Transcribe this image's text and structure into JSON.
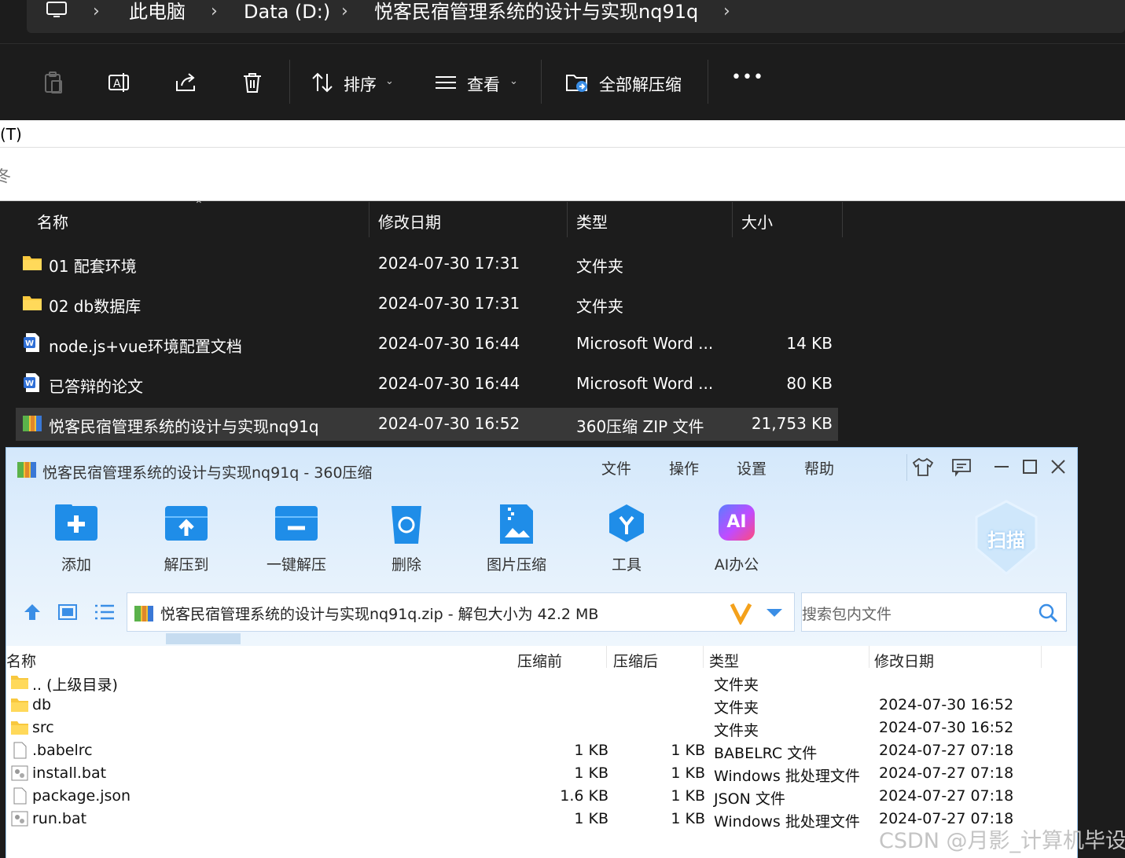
{
  "explorer": {
    "breadcrumb": [
      "此电脑",
      "Data (D:)",
      "悦客民宿管理系统的设计与实现nq91q"
    ],
    "toolbar": {
      "sort_label": "排序",
      "view_label": "查看",
      "extract_all_label": "全部解压缩",
      "more_label": "•••"
    },
    "strip_text_1": "(T)",
    "strip_text_2": "冬",
    "columns": {
      "name": "名称",
      "modified": "修改日期",
      "type": "类型",
      "size": "大小"
    },
    "files": [
      {
        "name": "01 配套环境",
        "modified": "2024-07-30 17:31",
        "type": "文件夹",
        "size": "",
        "icon": "folder-icon"
      },
      {
        "name": "02 db数据库",
        "modified": "2024-07-30 17:31",
        "type": "文件夹",
        "size": "",
        "icon": "folder-icon"
      },
      {
        "name": "node.js+vue环境配置文档",
        "modified": "2024-07-30 16:44",
        "type": "Microsoft Word ...",
        "size": "14 KB",
        "icon": "word-doc-icon"
      },
      {
        "name": "已答辩的论文",
        "modified": "2024-07-30 16:44",
        "type": "Microsoft Word ...",
        "size": "80 KB",
        "icon": "word-doc-icon"
      },
      {
        "name": "悦客民宿管理系统的设计与实现nq91q",
        "modified": "2024-07-30 16:52",
        "type": "360压缩 ZIP 文件",
        "size": "21,753 KB",
        "icon": "zip-archive-icon",
        "selected": true
      }
    ]
  },
  "archiver": {
    "title": "悦客民宿管理系统的设计与实现nq91q - 360压缩",
    "menu": [
      "文件",
      "操作",
      "设置",
      "帮助"
    ],
    "tools": [
      "添加",
      "解压到",
      "一键解压",
      "删除",
      "图片压缩",
      "工具",
      "AI办公"
    ],
    "scan_label": "扫描",
    "ai_badge": "AI",
    "address": "悦客民宿管理系统的设计与实现nq91q.zip - 解包大小为 42.2 MB",
    "search_placeholder": "搜索包内文件",
    "columns": {
      "name": "名称",
      "before": "压缩前",
      "after": "压缩后",
      "type": "类型",
      "modified": "修改日期"
    },
    "entries": [
      {
        "name": ".. (上级目录)",
        "before": "",
        "after": "",
        "type": "文件夹",
        "modified": "",
        "icon": "folder-icon"
      },
      {
        "name": "db",
        "before": "",
        "after": "",
        "type": "文件夹",
        "modified": "2024-07-30 16:52",
        "icon": "folder-icon"
      },
      {
        "name": "src",
        "before": "",
        "after": "",
        "type": "文件夹",
        "modified": "2024-07-30 16:52",
        "icon": "folder-icon"
      },
      {
        "name": ".babelrc",
        "before": "1 KB",
        "after": "1 KB",
        "type": "BABELRC 文件",
        "modified": "2024-07-27 07:18",
        "icon": "blank-file-icon"
      },
      {
        "name": "install.bat",
        "before": "1 KB",
        "after": "1 KB",
        "type": "Windows 批处理文件",
        "modified": "2024-07-27 07:18",
        "icon": "batch-file-icon"
      },
      {
        "name": "package.json",
        "before": "1.6 KB",
        "after": "1 KB",
        "type": "JSON 文件",
        "modified": "2024-07-27 07:18",
        "icon": "blank-file-icon"
      },
      {
        "name": "run.bat",
        "before": "1 KB",
        "after": "1 KB",
        "type": "Windows 批处理文件",
        "modified": "2024-07-27 07:18",
        "icon": "batch-file-icon"
      }
    ]
  },
  "watermark": "CSDN @月影_计算机毕设"
}
